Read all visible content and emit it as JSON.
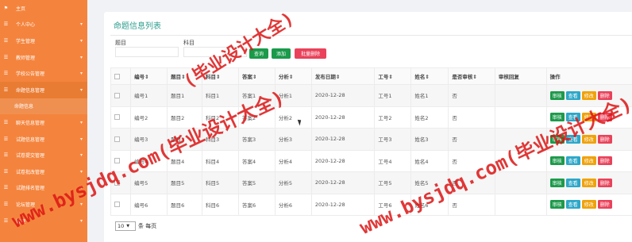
{
  "sidebar": {
    "items": [
      {
        "label": "主页",
        "icon": "flag-icon",
        "has_chevron": false
      },
      {
        "label": "个人中心",
        "icon": "bars-icon",
        "has_chevron": true
      },
      {
        "label": "学生管理",
        "icon": "bars-icon",
        "has_chevron": true
      },
      {
        "label": "教师管理",
        "icon": "bars-icon",
        "has_chevron": true
      },
      {
        "label": "学校公告管理",
        "icon": "bars-icon",
        "has_chevron": true
      },
      {
        "label": "命题信息管理",
        "icon": "bars-icon",
        "has_chevron": true,
        "active": true
      },
      {
        "label": "命题信息",
        "sub": true
      },
      {
        "label": "聊天信息管理",
        "icon": "bars-icon",
        "has_chevron": true
      },
      {
        "label": "试题信息管理",
        "icon": "bars-icon",
        "has_chevron": true
      },
      {
        "label": "试卷提交管理",
        "icon": "bars-icon",
        "has_chevron": true
      },
      {
        "label": "试卷批改管理",
        "icon": "bars-icon",
        "has_chevron": true
      },
      {
        "label": "试题排名管理",
        "icon": "bars-icon",
        "has_chevron": true
      },
      {
        "label": "论坛管理",
        "icon": "bars-icon",
        "has_chevron": true
      },
      {
        "label": "管理",
        "icon": "bars-icon",
        "has_chevron": true
      }
    ]
  },
  "main": {
    "title": "命题信息列表",
    "filters": {
      "field1_label": "题目",
      "field2_label": "科目"
    },
    "buttons": {
      "search": "查询",
      "add": "添加",
      "batch_delete": "批量删除"
    },
    "table": {
      "columns": [
        "编号⇕",
        "题目⇕",
        "科目⇕",
        "答案⇕",
        "分析⇕",
        "发布日期⇕",
        "工号⇕",
        "姓名⇕",
        "是否审核⇕",
        "审核回复",
        "操作"
      ],
      "rows": [
        [
          "编号1",
          "题目1",
          "科目1",
          "答案1",
          "分析1",
          "2020-12-28",
          "工号1",
          "姓名1",
          "否",
          ""
        ],
        [
          "编号2",
          "题目2",
          "科目2",
          "答案2",
          "分析2",
          "2020-12-28",
          "工号2",
          "姓名2",
          "否",
          ""
        ],
        [
          "编号3",
          "题目3",
          "科目3",
          "答案3",
          "分析3",
          "2020-12-28",
          "工号3",
          "姓名3",
          "否",
          ""
        ],
        [
          "编号4",
          "题目4",
          "科目4",
          "答案4",
          "分析4",
          "2020-12-28",
          "工号4",
          "姓名4",
          "否",
          ""
        ],
        [
          "编号5",
          "题目5",
          "科目5",
          "答案5",
          "分析5",
          "2020-12-28",
          "工号5",
          "姓名5",
          "否",
          ""
        ],
        [
          "编号6",
          "题目6",
          "科目6",
          "答案6",
          "分析6",
          "2020-12-28",
          "工号6",
          "姓名6",
          "否",
          ""
        ]
      ],
      "actions": {
        "audit": "审核",
        "view": "查看",
        "edit": "修改",
        "delete": "删除"
      }
    },
    "pager": {
      "page_size": "10",
      "suffix": "条 每页"
    }
  },
  "watermark": {
    "text1": "(毕业设计大全)",
    "text2": "www.bysjdq.com(毕业设计大全)",
    "color": "#dc1414"
  },
  "colors": {
    "sidebar": "#f4843d",
    "title": "#2e9e8e",
    "green": "#1a9a4a",
    "red": "#e9425a",
    "blue": "#2ea7c8",
    "orange": "#f0a20b"
  }
}
